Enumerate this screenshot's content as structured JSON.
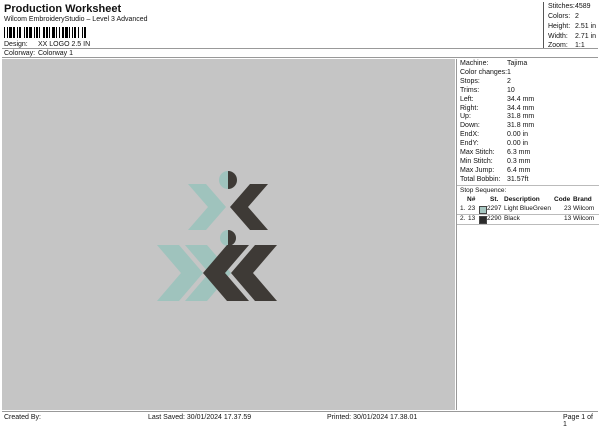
{
  "header": {
    "title": "Production Worksheet",
    "subtitle": "Wilcom EmbroideryStudio – Level 3 Advanced",
    "design_label": "Design:",
    "design_value": "XX LOGO 2.5 IN",
    "colorway_label": "Colorway:",
    "colorway_value": "Colorway 1"
  },
  "stats": {
    "stitches_label": "Stitches:",
    "stitches_value": "4589",
    "colors_label": "Colors:",
    "colors_value": "2",
    "height_label": "Height:",
    "height_value": "2.51 in",
    "width_label": "Width:",
    "width_value": "2.71 in",
    "zoom_label": "Zoom:",
    "zoom_value": "1:1"
  },
  "machine_info": [
    {
      "label": "Machine:",
      "value": "Tajima"
    },
    {
      "label": "Color changes:",
      "value": "1"
    },
    {
      "label": "Stops:",
      "value": "2"
    },
    {
      "label": "Trims:",
      "value": "10"
    },
    {
      "label": "Left:",
      "value": "34.4 mm"
    },
    {
      "label": "Right:",
      "value": "34.4 mm"
    },
    {
      "label": "Up:",
      "value": "31.8 mm"
    },
    {
      "label": "Down:",
      "value": "31.8 mm"
    },
    {
      "label": "EndX:",
      "value": "0.00 in"
    },
    {
      "label": "EndY:",
      "value": "0.00 in"
    },
    {
      "label": "Max Stitch:",
      "value": "6.3 mm"
    },
    {
      "label": "Min Stitch:",
      "value": "0.3 mm"
    },
    {
      "label": "Max Jump:",
      "value": "6.4 mm"
    },
    {
      "label": "Total Bobbin:",
      "value": "31.57ft"
    }
  ],
  "stop_sequence": {
    "title": "Stop Sequence:",
    "columns": {
      "num": "N#",
      "st": "St.",
      "desc": "Description",
      "code": "Code",
      "brand": "Brand"
    },
    "rows": [
      {
        "idx": "1.",
        "num": "23",
        "st": "2297",
        "desc": "Light BlueGreen",
        "code": "23",
        "brand": "Wilcom",
        "color": "#a6c7c1"
      },
      {
        "idx": "2.",
        "num": "13",
        "st": "2290",
        "desc": "Black",
        "code": "13",
        "brand": "Wilcom",
        "color": "#2b2b2b"
      }
    ]
  },
  "colors": {
    "canvas_bg": "#c5c5c5",
    "light_bluegreen": "#9fc3bd",
    "dark": "#3e3a36"
  },
  "footer": {
    "created_by": "Created By:",
    "last_saved": "Last Saved: 30/01/2024 17.37.59",
    "printed": "Printed: 30/01/2024 17.38.01",
    "page": "Page 1 of 1"
  }
}
